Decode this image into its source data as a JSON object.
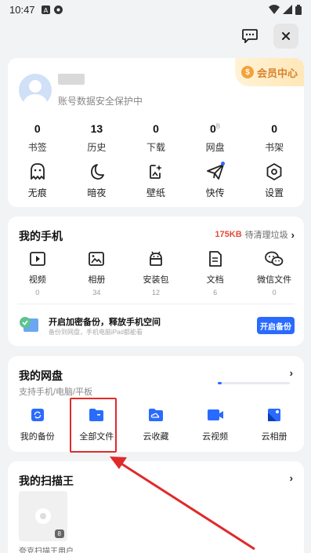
{
  "status_bar": {
    "time": "10:47"
  },
  "header": {
    "message_icon": "message-icon",
    "close_icon": "close-icon"
  },
  "profile": {
    "vip_label": "会员中心",
    "vip_coin": "$",
    "account_subtitle": "账号数据安全保护中",
    "stats": [
      {
        "num": "0",
        "label": "书签"
      },
      {
        "num": "13",
        "label": "历史"
      },
      {
        "num": "0",
        "label": "下载"
      },
      {
        "num": "0",
        "label": "网盘",
        "suffix": "B"
      },
      {
        "num": "0",
        "label": "书架"
      }
    ],
    "tools": [
      {
        "label": "无痕",
        "icon": "ghost-icon"
      },
      {
        "label": "暗夜",
        "icon": "moon-icon"
      },
      {
        "label": "壁纸",
        "icon": "wallpaper-icon"
      },
      {
        "label": "快传",
        "icon": "paper-plane-icon"
      },
      {
        "label": "设置",
        "icon": "settings-icon"
      }
    ]
  },
  "my_phone": {
    "title": "我的手机",
    "clean_size": "175KB",
    "clean_text": "待清理垃圾",
    "items": [
      {
        "label": "视频",
        "count": "0",
        "icon": "video-icon"
      },
      {
        "label": "相册",
        "count": "34",
        "icon": "album-icon"
      },
      {
        "label": "安装包",
        "count": "12",
        "icon": "android-icon"
      },
      {
        "label": "文档",
        "count": "6",
        "icon": "document-icon"
      },
      {
        "label": "微信文件",
        "count": "0",
        "icon": "wechat-icon"
      }
    ],
    "backup_title": "开启加密备份，释放手机空间",
    "backup_subtitle": "备份到网盘，手机电脑iPad都能看",
    "backup_button": "开启备份"
  },
  "my_disk": {
    "title": "我的网盘",
    "subtitle": "支持手机/电脑/平板",
    "usage_fraction": 0.05,
    "items": [
      {
        "label": "我的备份",
        "icon": "backup-icon"
      },
      {
        "label": "全部文件",
        "icon": "folder-icon"
      },
      {
        "label": "云收藏",
        "icon": "cloud-favorite-icon"
      },
      {
        "label": "云视频",
        "icon": "cloud-video-icon"
      },
      {
        "label": "云相册",
        "icon": "cloud-album-icon"
      }
    ]
  },
  "scanner": {
    "title": "我的扫描王",
    "doc_count": "8",
    "doc_name": "夸克扫描王用户"
  },
  "colors": {
    "accent": "#2a6bff",
    "annotation": "#e02a2a",
    "vip": "#d9822b"
  }
}
